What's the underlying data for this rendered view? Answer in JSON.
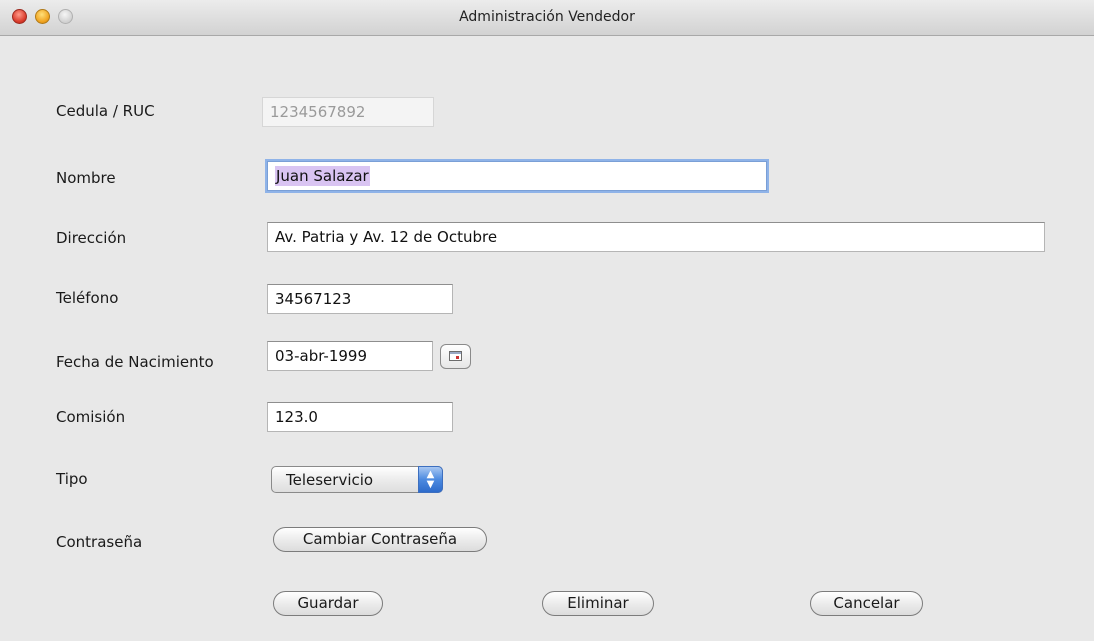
{
  "window": {
    "title": "Administración Vendedor"
  },
  "form": {
    "cedula": {
      "label": "Cedula / RUC",
      "value": "1234567892"
    },
    "nombre": {
      "label": "Nombre",
      "value": "Juan Salazar"
    },
    "direccion": {
      "label": "Dirección",
      "value": "Av. Patria y Av. 12 de Octubre"
    },
    "telefono": {
      "label": "Teléfono",
      "value": "34567123"
    },
    "fecha": {
      "label": "Fecha de Nacimiento",
      "value": "03-abr-1999"
    },
    "comision": {
      "label": "Comisión",
      "value": "123.0"
    },
    "tipo": {
      "label": "Tipo",
      "selected": "Teleservicio"
    },
    "contrasena": {
      "label": "Contraseña",
      "button_label": "Cambiar Contraseña"
    }
  },
  "actions": {
    "guardar": "Guardar",
    "eliminar": "Eliminar",
    "cancelar": "Cancelar"
  },
  "icons": {
    "calendar": "calendar-icon",
    "select_arrows": "updown-arrows-icon"
  },
  "colors": {
    "focus_ring": "#8fb3e8",
    "text_selection": "#d9c4f2",
    "select_accent": "#4c8ae0"
  }
}
